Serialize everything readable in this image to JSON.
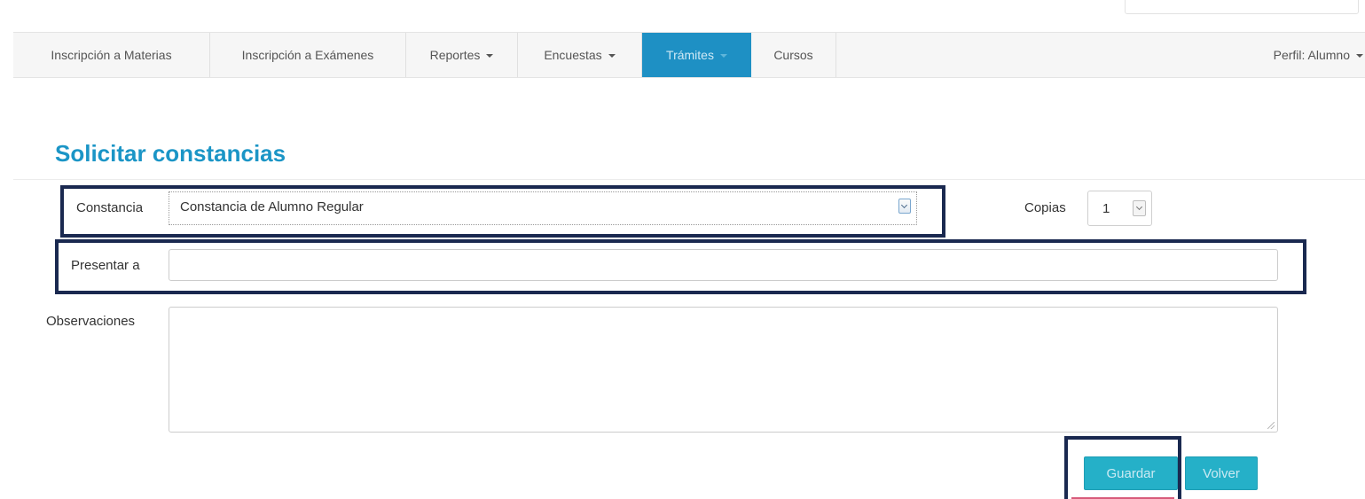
{
  "navbar": {
    "items": [
      {
        "label": "Inscripción a Materias",
        "dropdown": false,
        "active": false
      },
      {
        "label": "Inscripción a Exámenes",
        "dropdown": false,
        "active": false
      },
      {
        "label": "Reportes",
        "dropdown": true,
        "active": false
      },
      {
        "label": "Encuestas",
        "dropdown": true,
        "active": false
      },
      {
        "label": "Trámites",
        "dropdown": true,
        "active": true
      },
      {
        "label": "Cursos",
        "dropdown": false,
        "active": false
      }
    ],
    "profile_label": "Perfil: Alumno"
  },
  "page": {
    "title": "Solicitar constancias"
  },
  "form": {
    "constancia_label": "Constancia",
    "constancia_value": "Constancia de Alumno Regular",
    "copias_label": "Copias",
    "copias_value": "1",
    "presentar_label": "Presentar a",
    "presentar_value": "",
    "observaciones_label": "Observaciones",
    "observaciones_value": ""
  },
  "actions": {
    "save_label": "Guardar",
    "back_label": "Volver"
  },
  "colors": {
    "accent": "#1e90c4",
    "title": "#1b95c6",
    "button": "#25b0c8",
    "highlight_border": "#1a2950"
  }
}
